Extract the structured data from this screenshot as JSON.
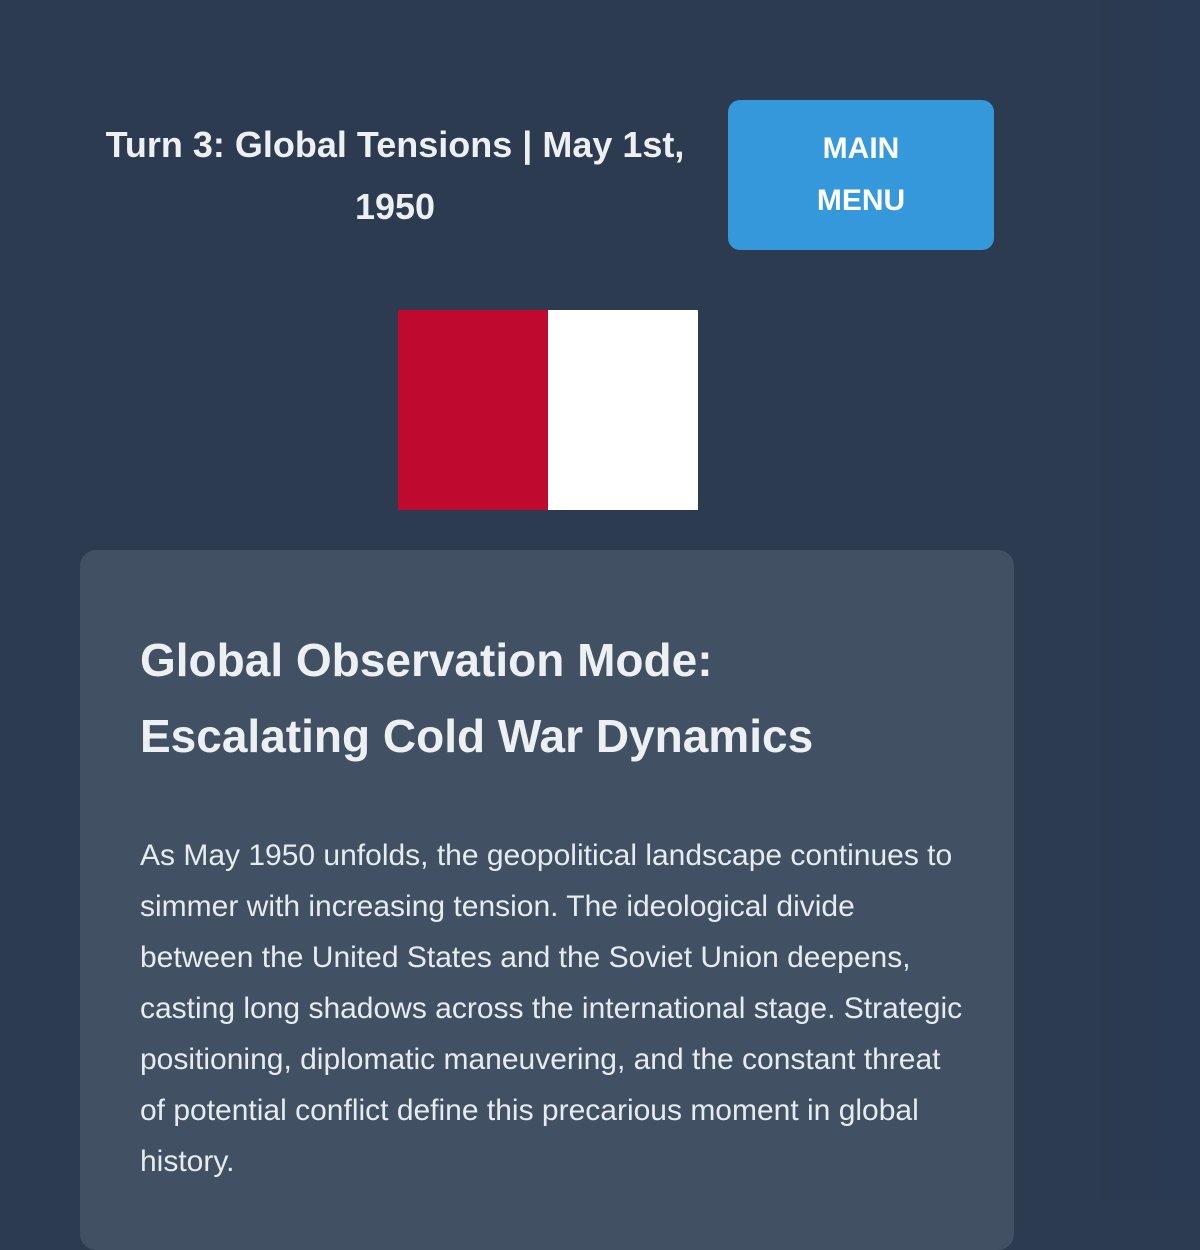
{
  "header": {
    "turn_title": "Turn 3: Global Tensions | May 1st, 1950",
    "main_menu_label": "MAIN MENU"
  },
  "flag": {
    "stripe_colors": [
      "#c0092e",
      "#ffffff"
    ]
  },
  "panel": {
    "title": "Global Observation Mode: Escalating Cold War Dynamics",
    "body": "As May 1950 unfolds, the geopolitical landscape continues to simmer with increasing tension. The ideological divide between the United States and the Soviet Union deepens, casting long shadows across the international stage. Strategic positioning, diplomatic maneuvering, and the constant threat of potential conflict define this precarious moment in global history."
  },
  "colors": {
    "background": "#2c3b4f",
    "panel": "#415163",
    "accent": "#3498db"
  }
}
